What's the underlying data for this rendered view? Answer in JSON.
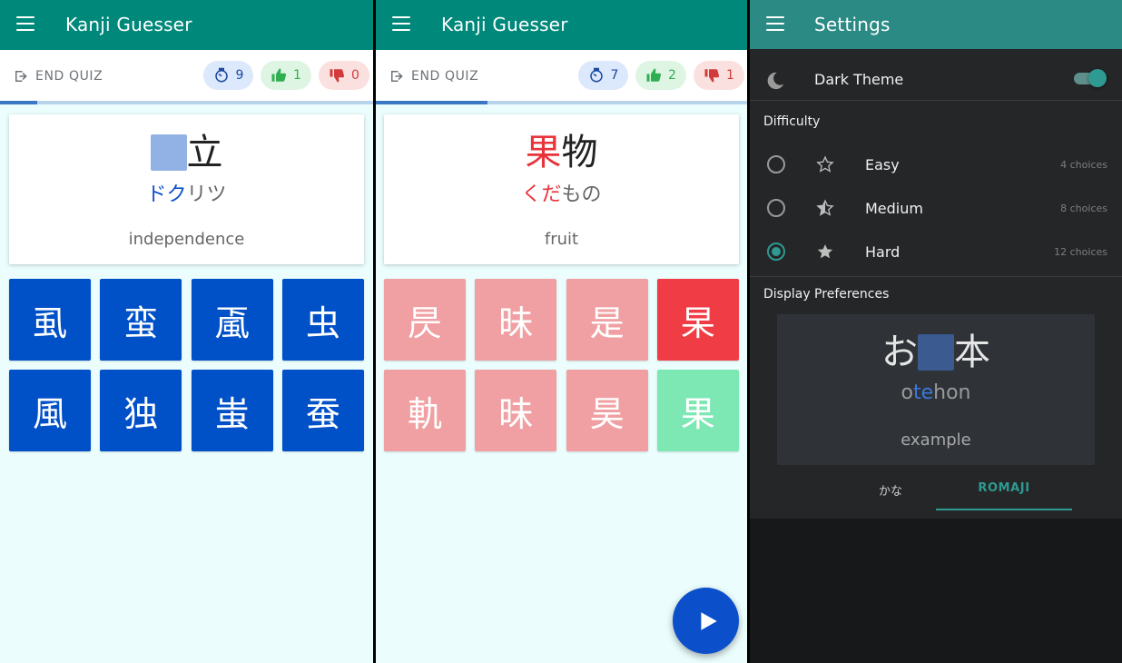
{
  "app": {
    "title": "Kanji Guesser",
    "end_quiz_label": "END QUIZ"
  },
  "quiz1": {
    "stats": {
      "timer": "9",
      "correct": "1",
      "wrong": "0"
    },
    "progress_fraction": 0.1,
    "kanji_shown": "立",
    "reading_highlight": "ドク",
    "reading_rest": "リツ",
    "meaning": "independence",
    "choices": [
      {
        "char": "虱",
        "color": "#0050c8"
      },
      {
        "char": "蛮",
        "color": "#0050c8"
      },
      {
        "char": "颪",
        "color": "#0050c8"
      },
      {
        "char": "虫",
        "color": "#0050c8"
      },
      {
        "char": "風",
        "color": "#0050c8"
      },
      {
        "char": "独",
        "color": "#0050c8"
      },
      {
        "char": "蚩",
        "color": "#0050c8"
      },
      {
        "char": "蚕",
        "color": "#0050c8"
      }
    ]
  },
  "quiz2": {
    "stats": {
      "timer": "7",
      "correct": "2",
      "wrong": "1"
    },
    "progress_fraction": 0.3,
    "kanji_answer": "果",
    "kanji_rest": "物",
    "reading_highlight": "くだ",
    "reading_rest": "もの",
    "meaning": "fruit",
    "choices": [
      {
        "char": "昃",
        "color": "#f0a0a2"
      },
      {
        "char": "昧",
        "color": "#f0a0a2"
      },
      {
        "char": "是",
        "color": "#f0a0a2"
      },
      {
        "char": "杲",
        "color": "#f03c44"
      },
      {
        "char": "軌",
        "color": "#f0a0a2"
      },
      {
        "char": "昧",
        "color": "#f0a0a2"
      },
      {
        "char": "昊",
        "color": "#f0a0a2"
      },
      {
        "char": "果",
        "color": "#7de8b4"
      }
    ]
  },
  "settings": {
    "title": "Settings",
    "dark_theme_label": "Dark Theme",
    "dark_theme_on": true,
    "difficulty_title": "Difficulty",
    "difficulties": [
      {
        "label": "Easy",
        "count": "4 choices",
        "selected": false
      },
      {
        "label": "Medium",
        "count": "8 choices",
        "selected": false
      },
      {
        "label": "Hard",
        "count": "12 choices",
        "selected": true
      }
    ],
    "display_title": "Display Preferences",
    "preview": {
      "kanji_before": "お",
      "kanji_after": "本",
      "reading_before": "o",
      "reading_highlight": "te",
      "reading_after": "hon",
      "meaning": "example"
    },
    "tabs": {
      "kana": "かな",
      "romaji": "ROMAJI",
      "selected": "romaji"
    }
  },
  "colors": {
    "teal": "#00897b",
    "blue": "#0050c8",
    "accent_dark": "#2e9a91"
  }
}
